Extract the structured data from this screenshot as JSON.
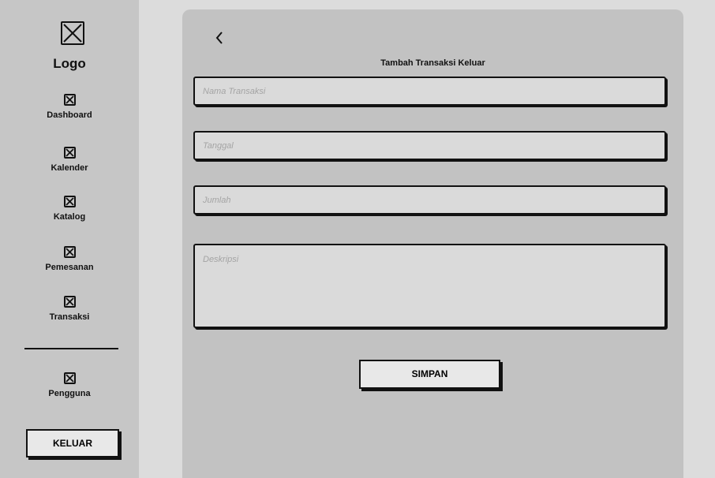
{
  "sidebar": {
    "logo_text": "Logo",
    "items": [
      {
        "label": "Dashboard",
        "icon": "placeholder-x-icon"
      },
      {
        "label": "Kalender",
        "icon": "placeholder-x-icon"
      },
      {
        "label": "Katalog",
        "icon": "placeholder-x-icon"
      },
      {
        "label": "Pemesanan",
        "icon": "placeholder-x-icon"
      },
      {
        "label": "Transaksi",
        "icon": "placeholder-x-icon"
      }
    ],
    "bottom_item": {
      "label": "Pengguna",
      "icon": "placeholder-x-icon"
    },
    "logout_label": "KELUAR"
  },
  "main": {
    "back_icon": "chevron-left-icon",
    "title": "Tambah Transaksi Keluar",
    "fields": {
      "nama_transaksi": {
        "placeholder": "Nama Transaksi",
        "value": ""
      },
      "tanggal": {
        "placeholder": "Tanggal",
        "value": ""
      },
      "jumlah": {
        "placeholder": "Jumlah",
        "value": ""
      },
      "deskripsi": {
        "placeholder": "Deskripsi",
        "value": ""
      }
    },
    "save_label": "SIMPAN"
  },
  "colors": {
    "page_background": "#dcdcdc",
    "sidebar_background": "#c6c6c6",
    "card_background": "#c2c2c2",
    "field_background": "#dadada",
    "button_background": "#e8e8e8",
    "border": "#111111",
    "placeholder_text": "#a4a4a4"
  }
}
